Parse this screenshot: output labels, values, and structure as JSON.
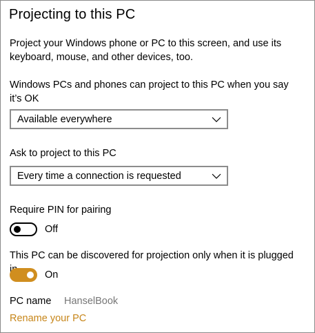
{
  "page": {
    "title": "Projecting to this PC",
    "description": "Project your Windows phone or PC to this screen, and use its keyboard, mouse, and other devices, too."
  },
  "availability": {
    "label": "Windows PCs and phones can project to this PC when you say it’s OK",
    "selected": "Available everywhere"
  },
  "ask_to_project": {
    "label": "Ask to project to this PC",
    "selected": "Every time a connection is requested"
  },
  "require_pin": {
    "label": "Require PIN for pairing",
    "state_label": "Off",
    "on": false
  },
  "plugged_in": {
    "label": "This PC can be discovered for projection only when it is plugged in",
    "state_label": "On",
    "on": true
  },
  "pc_name": {
    "label": "PC name",
    "value": "HanselBook",
    "rename_link": "Rename your PC"
  },
  "colors": {
    "accent": "#d08e1f",
    "link": "#c7861a",
    "muted_text": "#767676"
  },
  "icons": {
    "dropdown_chevron": "chevron-down-icon"
  }
}
